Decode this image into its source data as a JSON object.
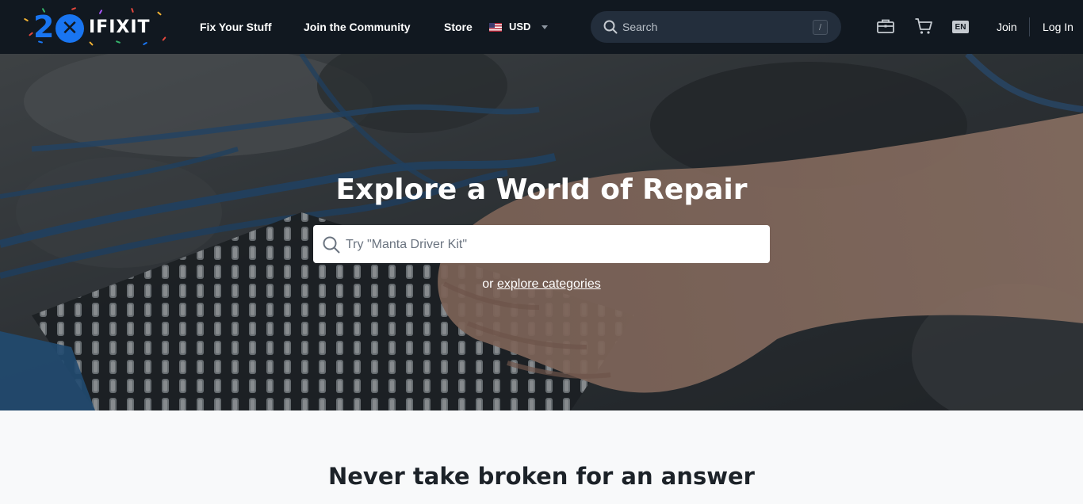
{
  "brand": {
    "logo_number": "2",
    "logo_text": "IFIXIT",
    "accent_color": "#1975f1"
  },
  "nav": {
    "links": [
      "Fix Your Stuff",
      "Join the Community",
      "Store"
    ],
    "currency": "USD",
    "currency_flag": "us-flag-icon",
    "search_placeholder": "Search",
    "search_shortcut": "/",
    "language": "EN",
    "join_label": "Join",
    "login_label": "Log In",
    "icons": [
      "toolbox-icon",
      "cart-icon"
    ]
  },
  "hero": {
    "title": "Explore a World of Repair",
    "search_placeholder": "Try \"Manta Driver Kit\"",
    "sub_prefix": "or",
    "sub_link": "explore categories"
  },
  "section": {
    "title": "Never take broken for an answer"
  }
}
